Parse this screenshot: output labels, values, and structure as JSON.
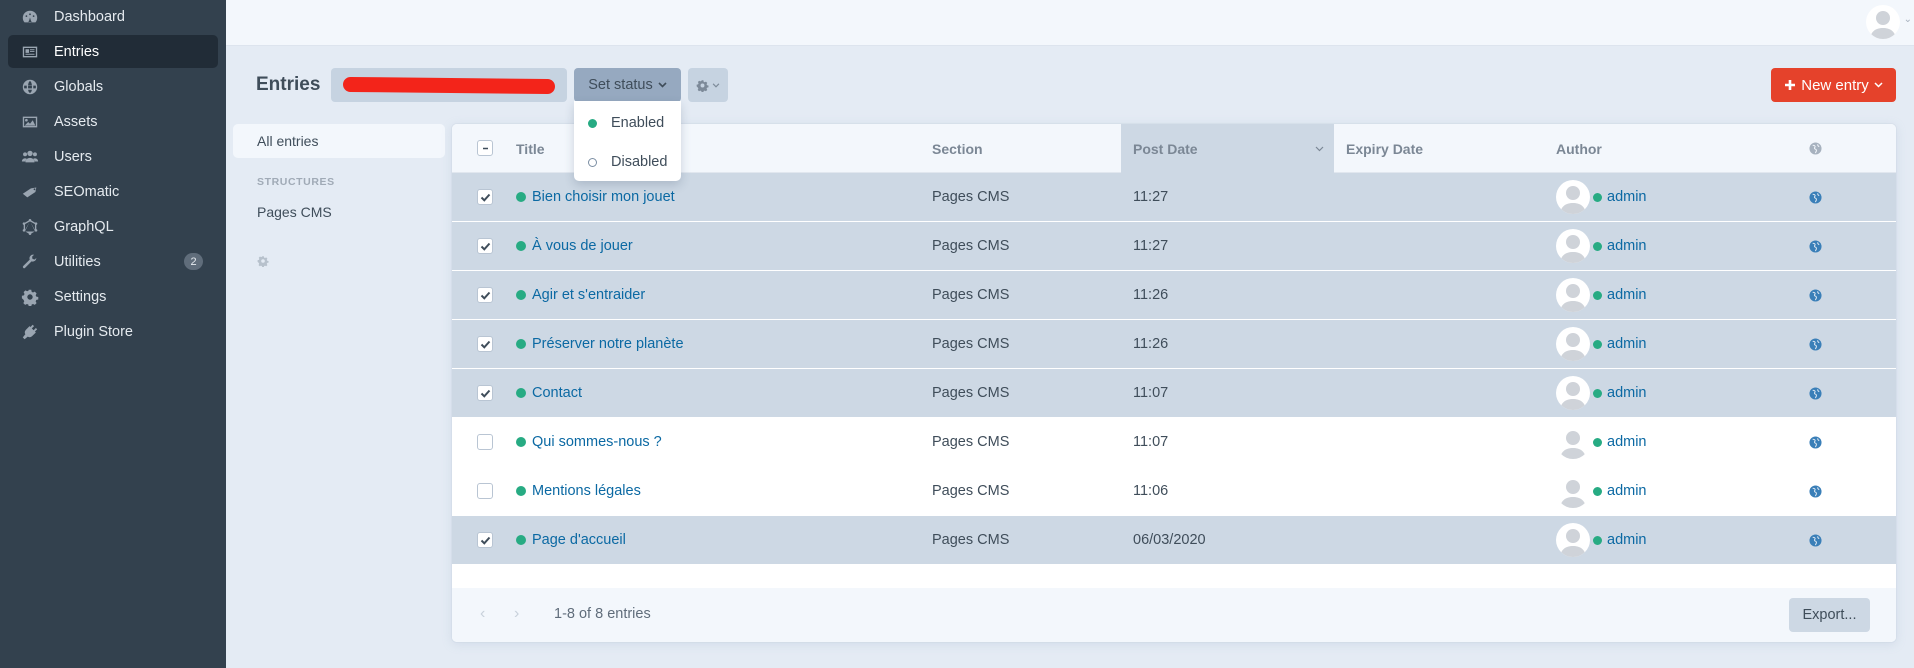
{
  "sidebar": {
    "items": [
      {
        "label": "Dashboard",
        "icon": "gauge-icon",
        "active": false
      },
      {
        "label": "Entries",
        "icon": "newspaper-icon",
        "active": true
      },
      {
        "label": "Globals",
        "icon": "globe-icon",
        "active": false
      },
      {
        "label": "Assets",
        "icon": "image-icon",
        "active": false
      },
      {
        "label": "Users",
        "icon": "users-icon",
        "active": false
      },
      {
        "label": "SEOmatic",
        "icon": "seo-tag-icon",
        "active": false
      },
      {
        "label": "GraphQL",
        "icon": "graphql-icon",
        "active": false
      },
      {
        "label": "Utilities",
        "icon": "wrench-icon",
        "active": false,
        "badge": "2"
      },
      {
        "label": "Settings",
        "icon": "gear-icon",
        "active": false
      },
      {
        "label": "Plugin Store",
        "icon": "plug-icon",
        "active": false
      }
    ]
  },
  "header": {
    "title": "Entries",
    "set_status_label": "Set status",
    "new_entry_label": "New entry",
    "new_entry_color": "#e5422b"
  },
  "status_menu": {
    "items": [
      {
        "label": "Enabled",
        "color": "#27ab83"
      },
      {
        "label": "Disabled"
      }
    ]
  },
  "sources": {
    "all_label": "All entries",
    "heading": "STRUCTURES",
    "items": [
      "Pages CMS"
    ]
  },
  "table": {
    "columns": {
      "title": "Title",
      "section": "Section",
      "post_date": "Post Date",
      "expiry_date": "Expiry Date",
      "author": "Author"
    },
    "rows": [
      {
        "title": "Bien choisir mon jouet",
        "section": "Pages CMS",
        "post_date": "11:27",
        "expiry_date": "",
        "author": "admin",
        "selected": true
      },
      {
        "title": "À vous de jouer",
        "section": "Pages CMS",
        "post_date": "11:27",
        "expiry_date": "",
        "author": "admin",
        "selected": true
      },
      {
        "title": "Agir et s'entraider",
        "section": "Pages CMS",
        "post_date": "11:26",
        "expiry_date": "",
        "author": "admin",
        "selected": true
      },
      {
        "title": "Préserver notre planète",
        "section": "Pages CMS",
        "post_date": "11:26",
        "expiry_date": "",
        "author": "admin",
        "selected": true
      },
      {
        "title": "Contact",
        "section": "Pages CMS",
        "post_date": "11:07",
        "expiry_date": "",
        "author": "admin",
        "selected": true
      },
      {
        "title": "Qui sommes-nous ?",
        "section": "Pages CMS",
        "post_date": "11:07",
        "expiry_date": "",
        "author": "admin",
        "selected": false
      },
      {
        "title": "Mentions légales",
        "section": "Pages CMS",
        "post_date": "11:06",
        "expiry_date": "",
        "author": "admin",
        "selected": false
      },
      {
        "title": "Page d'accueil",
        "section": "Pages CMS",
        "post_date": "06/03/2020",
        "expiry_date": "",
        "author": "admin",
        "selected": true
      }
    ]
  },
  "footer": {
    "pagination_text": "1-8 of 8 entries",
    "export_label": "Export..."
  }
}
